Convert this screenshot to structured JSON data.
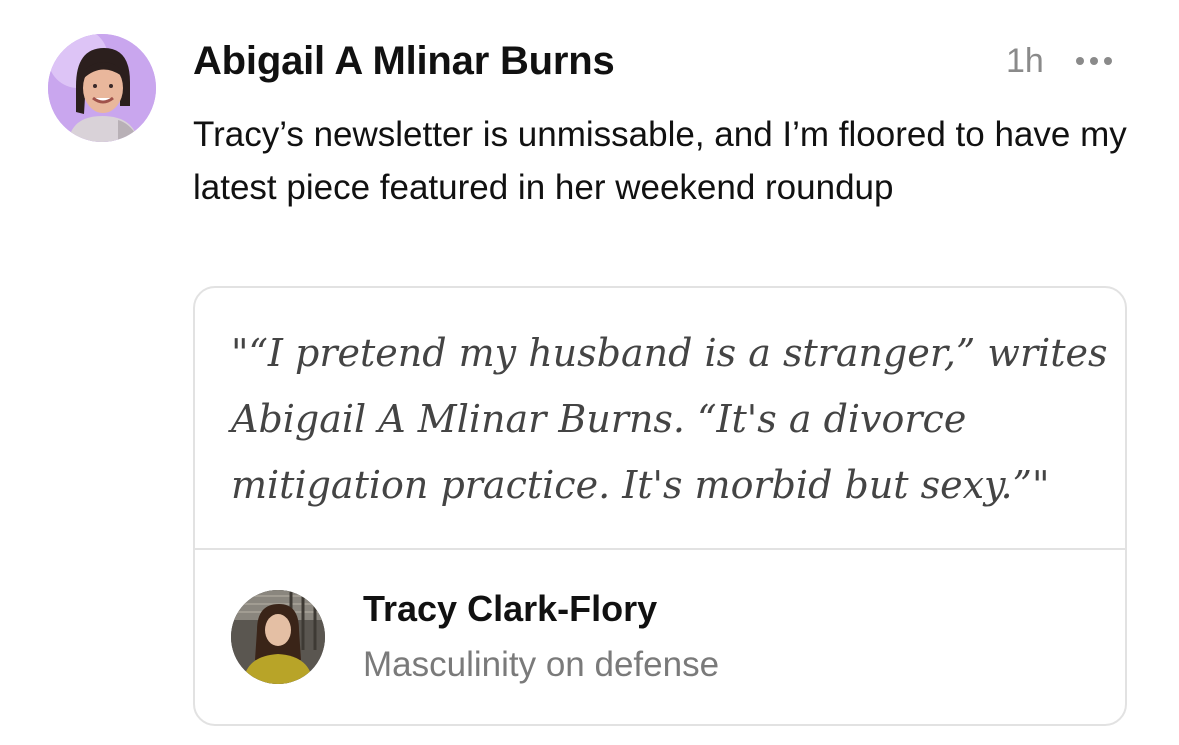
{
  "note": {
    "author": {
      "name": "Abigail A Mlinar Burns",
      "avatar_icon": "author-avatar-photo"
    },
    "timestamp": "1h",
    "more_icon": "more-options-icon",
    "body": "Tracy’s newsletter is unmissable, and I’m floored to have my latest piece featured in her weekend roundup"
  },
  "quote_card": {
    "text": "\"“I pretend my husband is a stranger,” writes Abigail A Mlinar Burns. “It's a divorce mitigation practice. It's morbid but sexy.”\"",
    "author": "Tracy Clark-Flory",
    "post_title": "Masculinity on defense",
    "avatar_icon": "quote-author-avatar-photo"
  },
  "colors": {
    "text_primary": "#111111",
    "text_muted": "#8a8a8a",
    "quote_text": "#444444",
    "border": "#e2e2e2",
    "author_avatar_bg": "#c9a6ee"
  }
}
